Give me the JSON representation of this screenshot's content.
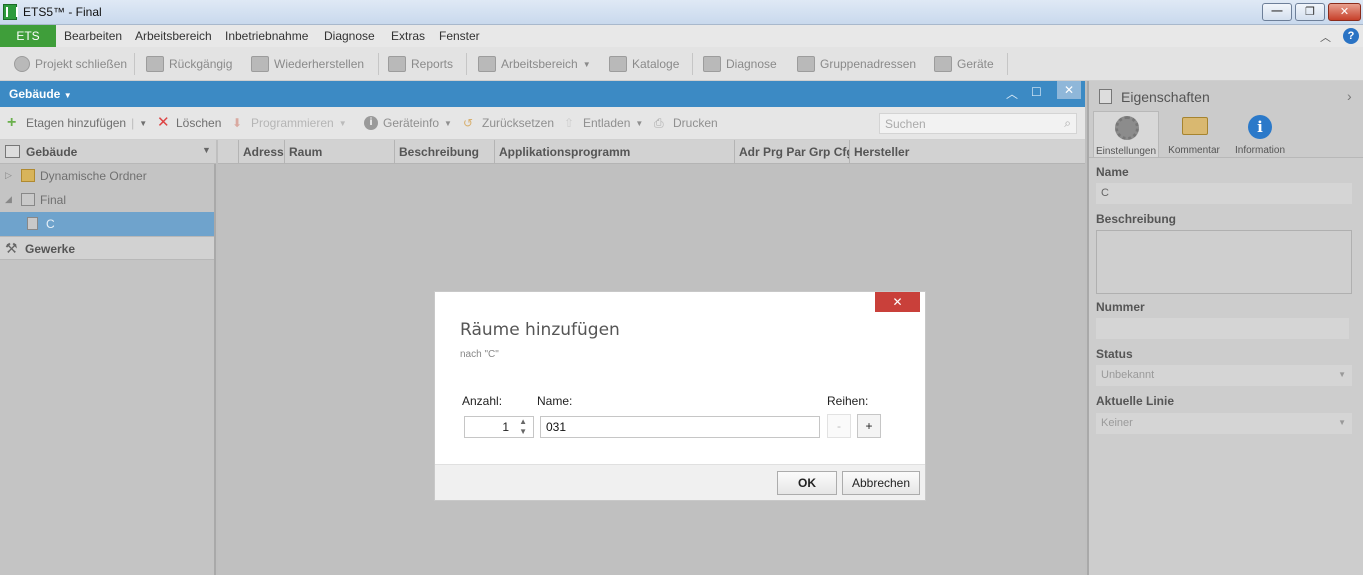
{
  "window": {
    "title": "ETS5™ - Final"
  },
  "menu": {
    "ets": "ETS",
    "items": [
      "Bearbeiten",
      "Arbeitsbereich",
      "Inbetriebnahme",
      "Diagnose",
      "Extras",
      "Fenster"
    ]
  },
  "toolbar": {
    "items": [
      "Projekt schließen",
      "Rückgängig",
      "Wiederherstellen",
      "Reports",
      "Arbeitsbereich",
      "Kataloge",
      "Diagnose",
      "Gruppenadressen",
      "Geräte"
    ]
  },
  "left_panel": {
    "title": "Gebäude",
    "actions": [
      "Etagen hinzufügen",
      "Löschen",
      "Programmieren",
      "Geräteinfo",
      "Zurücksetzen",
      "Entladen",
      "Drucken"
    ],
    "search_placeholder": "Suchen"
  },
  "tree": {
    "header": "Gebäude",
    "items": [
      "Dynamische Ordner",
      "Final",
      "C"
    ],
    "gewerke": "Gewerke"
  },
  "grid": {
    "columns": [
      "Adresse",
      "Raum",
      "Beschreibung",
      "Applikationsprogramm",
      "Adr Prg Par Grp Cfg",
      "Hersteller"
    ]
  },
  "properties": {
    "title": "Eigenschaften",
    "tabs": [
      "Einstellungen",
      "Kommentar",
      "Information"
    ],
    "name_label": "Name",
    "name_value": "C",
    "beschreibung_label": "Beschreibung",
    "nummer_label": "Nummer",
    "status_label": "Status",
    "status_value": "Unbekannt",
    "linie_label": "Aktuelle Linie",
    "linie_value": "Keiner"
  },
  "dialog": {
    "title": "Räume hinzufügen",
    "subtitle": "nach \"C\"",
    "anzahl_label": "Anzahl:",
    "anzahl_value": "1",
    "name_label": "Name:",
    "name_value": "031",
    "reihen_label": "Reihen:",
    "minus": "-",
    "plus": "+",
    "ok": "OK",
    "cancel": "Abbrechen",
    "close": "✕"
  }
}
